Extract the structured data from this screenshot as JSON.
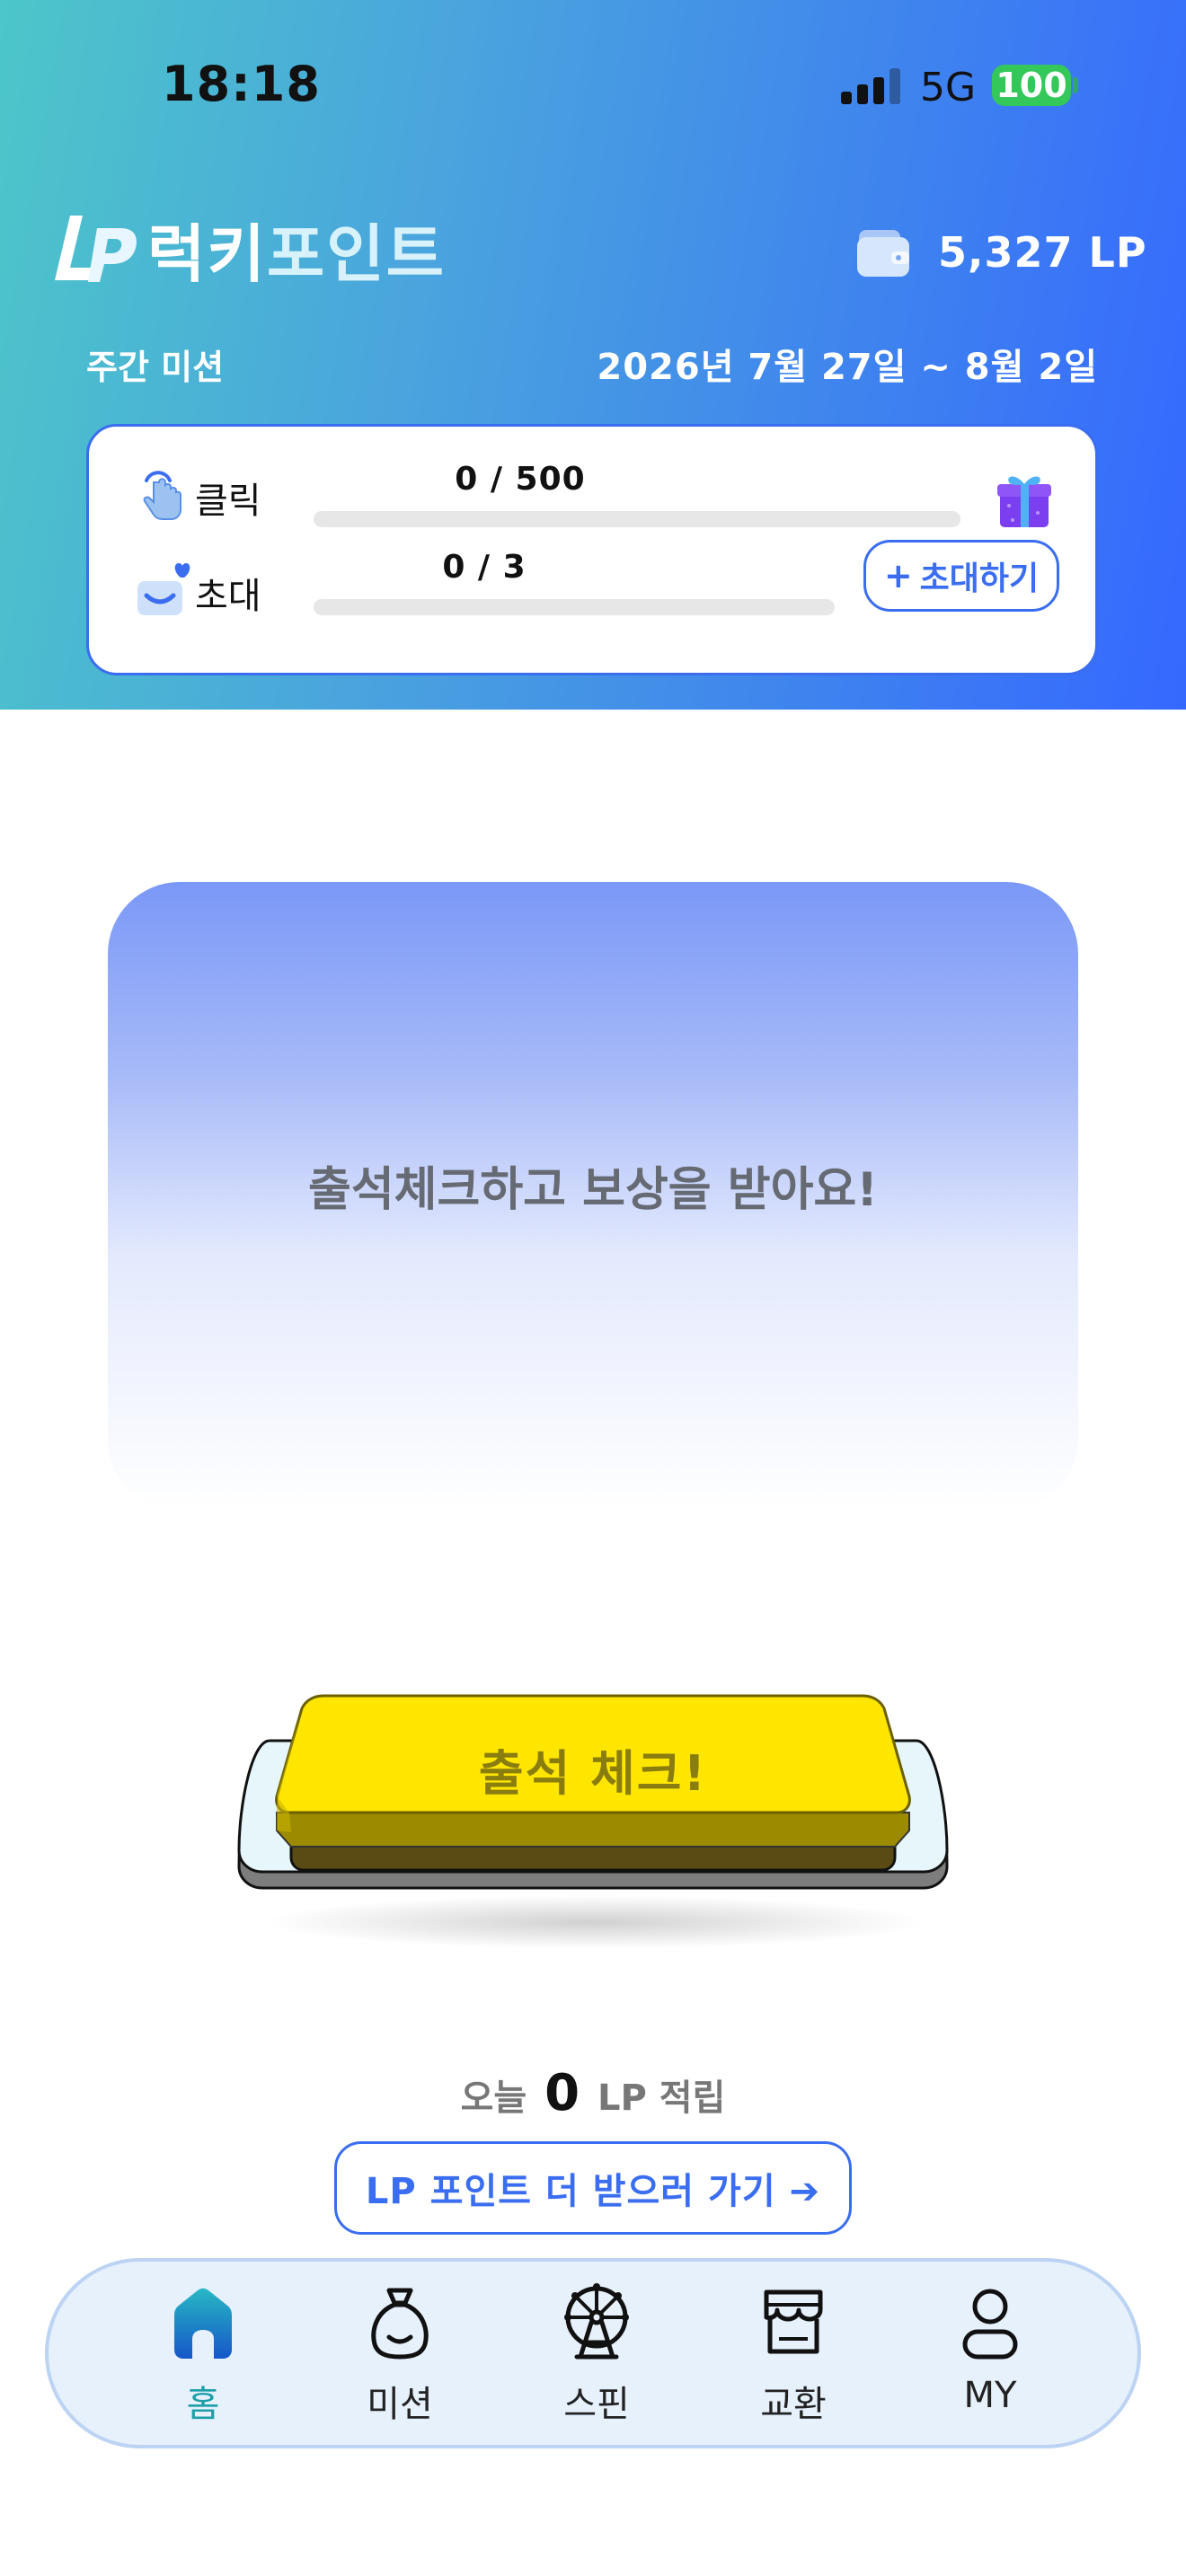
{
  "status_bar": {
    "time": "18:18",
    "network": "5G",
    "battery": "100"
  },
  "brand": {
    "logo_text": "LP",
    "name_bold": "럭키",
    "name_light": "포인트"
  },
  "wallet": {
    "amount": "5,327 LP",
    "icon": "wallet-icon"
  },
  "weekly_mission": {
    "label": "주간 미션",
    "range": "2026년 7월 27일 ~ 8월 2일",
    "click": {
      "label": "클릭",
      "count": "0 / 500",
      "progress": 0,
      "icon": "pointer-tap-icon",
      "reward_icon": "gift-icon"
    },
    "invite": {
      "label": "초대",
      "count": "0 / 3",
      "progress": 0,
      "icon": "invite-heart-icon",
      "button_label": "초대하기",
      "button_icon": "plus-icon"
    }
  },
  "attendance": {
    "title": "출석체크하고 보상을 받아요!",
    "button_label": "출석 체크!",
    "today_prefix": "오늘",
    "today_value": "0",
    "today_suffix": "LP 적립",
    "more_button": "LP 포인트 더 받으러 가기 ➔"
  },
  "bottom_nav": {
    "items": [
      {
        "label": "홈",
        "icon": "home-icon",
        "active": true
      },
      {
        "label": "미션",
        "icon": "money-bag-icon",
        "active": false
      },
      {
        "label": "스핀",
        "icon": "ferris-wheel-icon",
        "active": false
      },
      {
        "label": "교환",
        "icon": "store-icon",
        "active": false
      },
      {
        "label": "MY",
        "icon": "user-icon",
        "active": false
      }
    ]
  },
  "colors": {
    "accent": "#3a6df0",
    "active_nav": "#1d9fa8",
    "button_yellow": "#ffe600"
  }
}
